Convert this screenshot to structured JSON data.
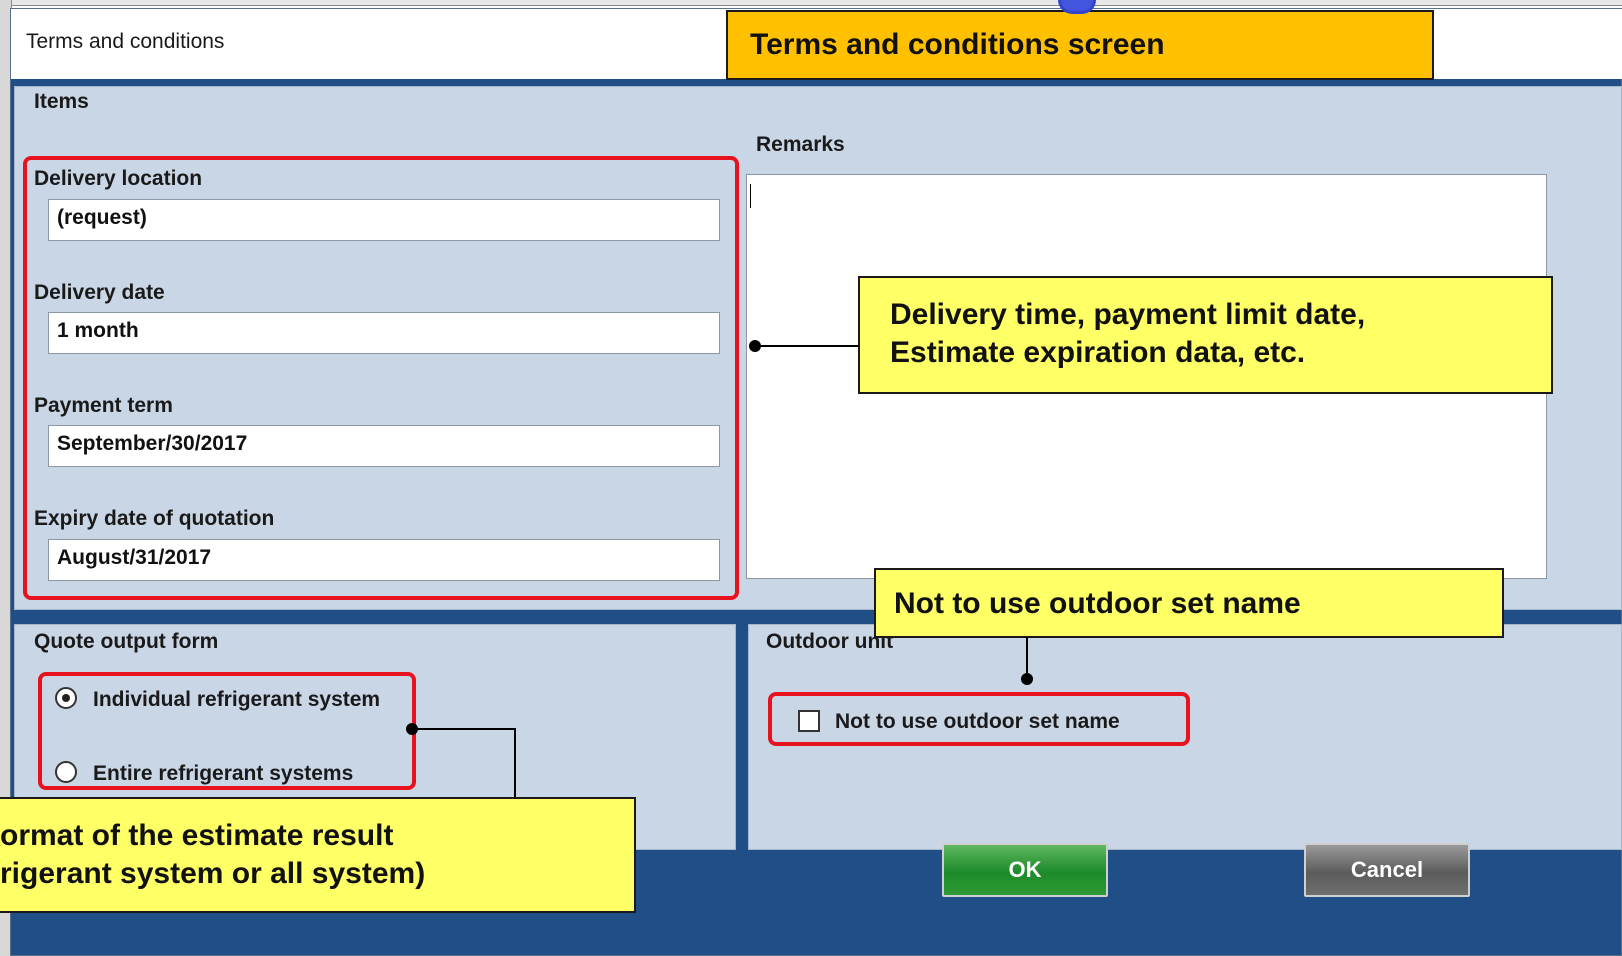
{
  "dialog": {
    "title": "Terms and conditions",
    "banner": "Terms and conditions screen"
  },
  "items": {
    "section_label": "Items",
    "delivery_location": {
      "label": "Delivery location",
      "value": "(request)"
    },
    "delivery_date": {
      "label": "Delivery date",
      "value": "1 month"
    },
    "payment_term": {
      "label": "Payment term",
      "value": "September/30/2017"
    },
    "expiry_date": {
      "label": "Expiry date of quotation",
      "value": "August/31/2017"
    },
    "remarks_label": "Remarks",
    "remarks_value": ""
  },
  "quote_output": {
    "section_label": "Quote output form",
    "options": [
      {
        "label": "Individual refrigerant system",
        "selected": true
      },
      {
        "label": "Entire refrigerant systems",
        "selected": false
      }
    ]
  },
  "outdoor_unit": {
    "section_label": "Outdoor unit",
    "checkbox_label": "Not to use outdoor set name",
    "checked": false
  },
  "buttons": {
    "ok": "OK",
    "cancel": "Cancel"
  },
  "annotations": {
    "remarks_callout_line1": "Delivery time, payment limit date,",
    "remarks_callout_line2": "Estimate expiration data, etc.",
    "outdoor_callout": "Not to use outdoor set name",
    "format_callout_line1": "ormat of the estimate result",
    "format_callout_line2": "rigerant system or all system)"
  },
  "colors": {
    "dialog_background": "#1f4f86",
    "panel_background": "#c9d6e6",
    "highlight_red": "#e8121f",
    "callout_yellow": "#ffff66",
    "banner_orange": "#ffc000",
    "ok_green": "#1d8a2a",
    "cancel_gray": "#5c5c5c"
  }
}
